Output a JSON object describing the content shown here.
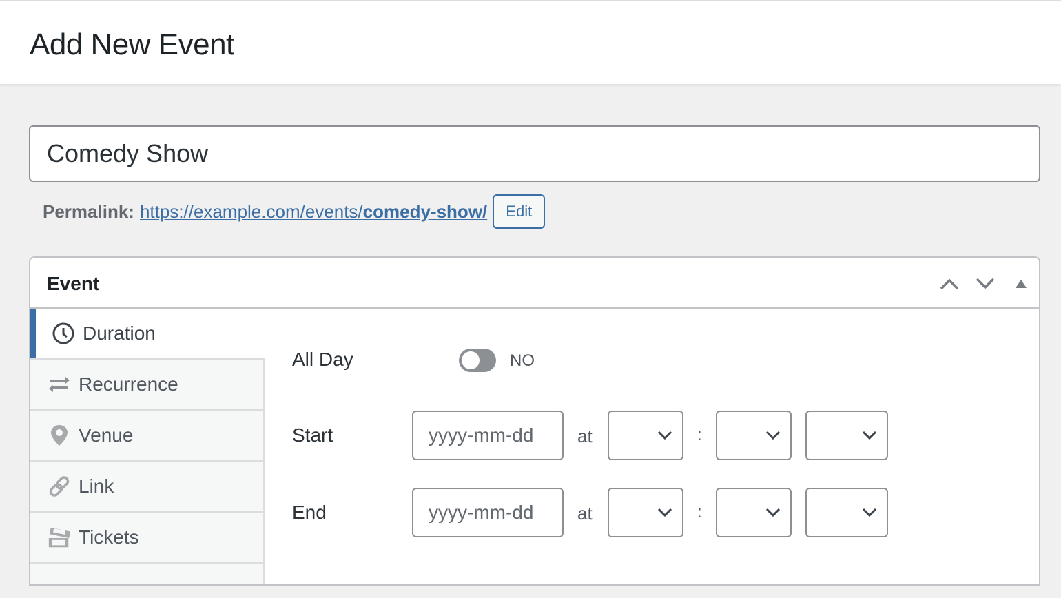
{
  "header": {
    "title": "Add New Event"
  },
  "post_title": {
    "value": "Comedy Show"
  },
  "permalink": {
    "label": "Permalink:",
    "url_base": "https://example.com/events/",
    "slug": "comedy-show/",
    "edit_label": "Edit"
  },
  "event_box": {
    "title": "Event",
    "controls": [
      "move-up-icon",
      "move-down-icon",
      "toggle-panel-icon"
    ],
    "tabs": [
      {
        "label": "Duration",
        "icon": "clock-icon",
        "active": true
      },
      {
        "label": "Recurrence",
        "icon": "repeat-icon",
        "active": false
      },
      {
        "label": "Venue",
        "icon": "location-pin-icon",
        "active": false
      },
      {
        "label": "Link",
        "icon": "link-icon",
        "active": false
      },
      {
        "label": "Tickets",
        "icon": "tickets-icon",
        "active": false
      }
    ],
    "duration": {
      "all_day_label": "All Day",
      "all_day_value": "NO",
      "start_label": "Start",
      "end_label": "End",
      "date_placeholder": "yyyy-mm-dd",
      "at_label": "at",
      "time_separator": ":",
      "start": {
        "date": "",
        "hour": "",
        "minute": "",
        "meridiem": ""
      },
      "end": {
        "date": "",
        "hour": "",
        "minute": "",
        "meridiem": ""
      }
    }
  },
  "colors": {
    "accent": "#3a6ea5",
    "background": "#f0f0f1",
    "border": "#c3c4c7"
  }
}
